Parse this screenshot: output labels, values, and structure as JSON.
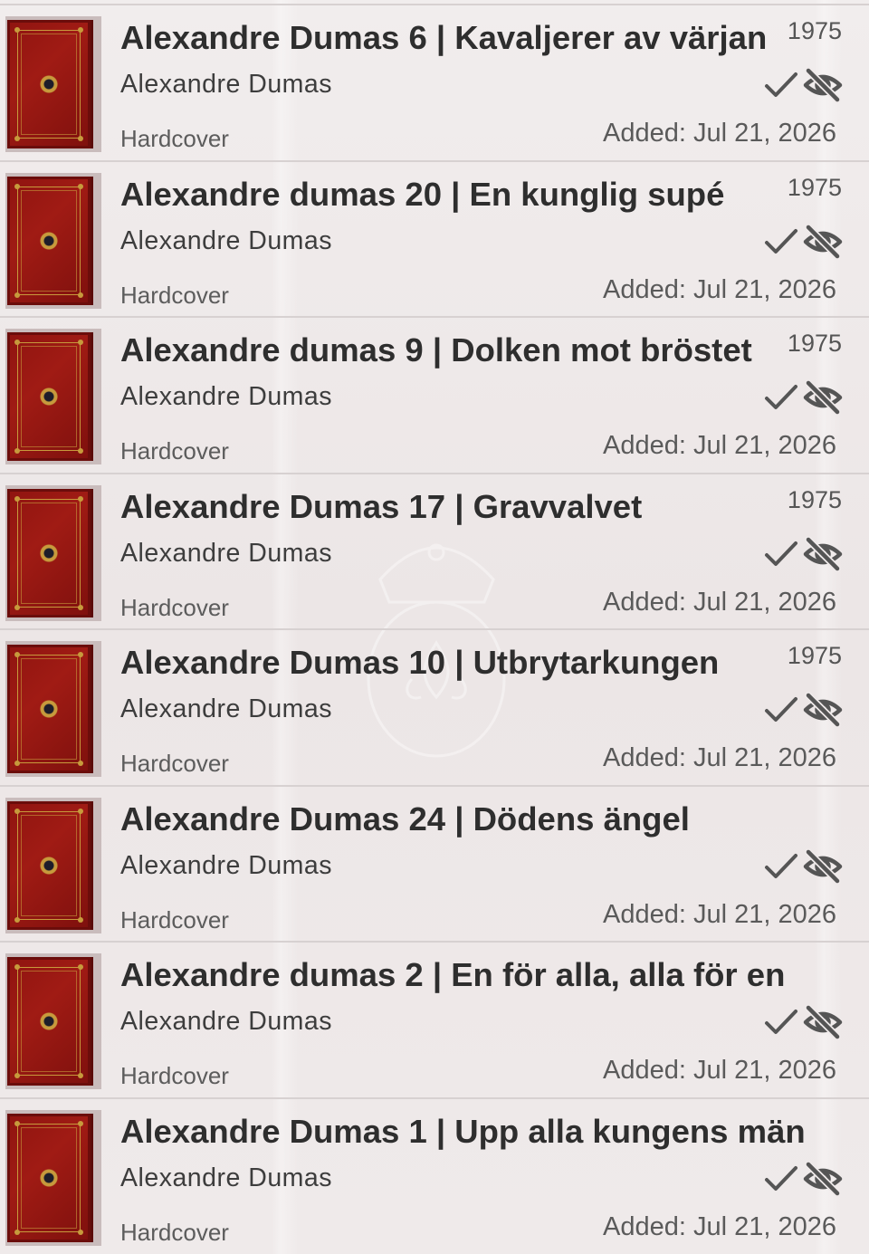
{
  "books": [
    {
      "title": "Alexandre Dumas 6 | Kavaljerer av värjan",
      "year": "1975",
      "author": "Alexandre Dumas",
      "format": "Hardcover",
      "added": "Added: Jul 21, 2026"
    },
    {
      "title": "Alexandre dumas 20 | En kunglig supé",
      "year": "1975",
      "author": "Alexandre Dumas",
      "format": "Hardcover",
      "added": "Added: Jul 21, 2026"
    },
    {
      "title": "Alexandre dumas 9 | Dolken mot bröstet",
      "year": "1975",
      "author": "Alexandre Dumas",
      "format": "Hardcover",
      "added": "Added: Jul 21, 2026"
    },
    {
      "title": "Alexandre Dumas 17 | Gravvalvet",
      "year": "1975",
      "author": "Alexandre Dumas",
      "format": "Hardcover",
      "added": "Added: Jul 21, 2026"
    },
    {
      "title": "Alexandre Dumas 10 | Utbrytarkungen",
      "year": "1975",
      "author": "Alexandre Dumas",
      "format": "Hardcover",
      "added": "Added: Jul 21, 2026"
    },
    {
      "title": "Alexandre Dumas 24 | Dödens ängel",
      "year": "",
      "author": "Alexandre Dumas",
      "format": "Hardcover",
      "added": "Added: Jul 21, 2026"
    },
    {
      "title": "Alexandre dumas 2 | En för alla, alla för en",
      "year": "",
      "author": "Alexandre Dumas",
      "format": "Hardcover",
      "added": "Added: Jul 21, 2026"
    },
    {
      "title": "Alexandre Dumas 1 | Upp alla kungens män",
      "year": "",
      "author": "Alexandre Dumas",
      "format": "Hardcover",
      "added": "Added: Jul 21, 2026"
    }
  ],
  "icons": {
    "check": "check-icon",
    "hidden": "eye-off-icon",
    "cover": "book-cover-thumbnail"
  },
  "colors": {
    "cover_red": "#9a1812",
    "cover_gold": "#c79a3c",
    "title_text": "#2e2e2e",
    "background": "#efeaea"
  }
}
